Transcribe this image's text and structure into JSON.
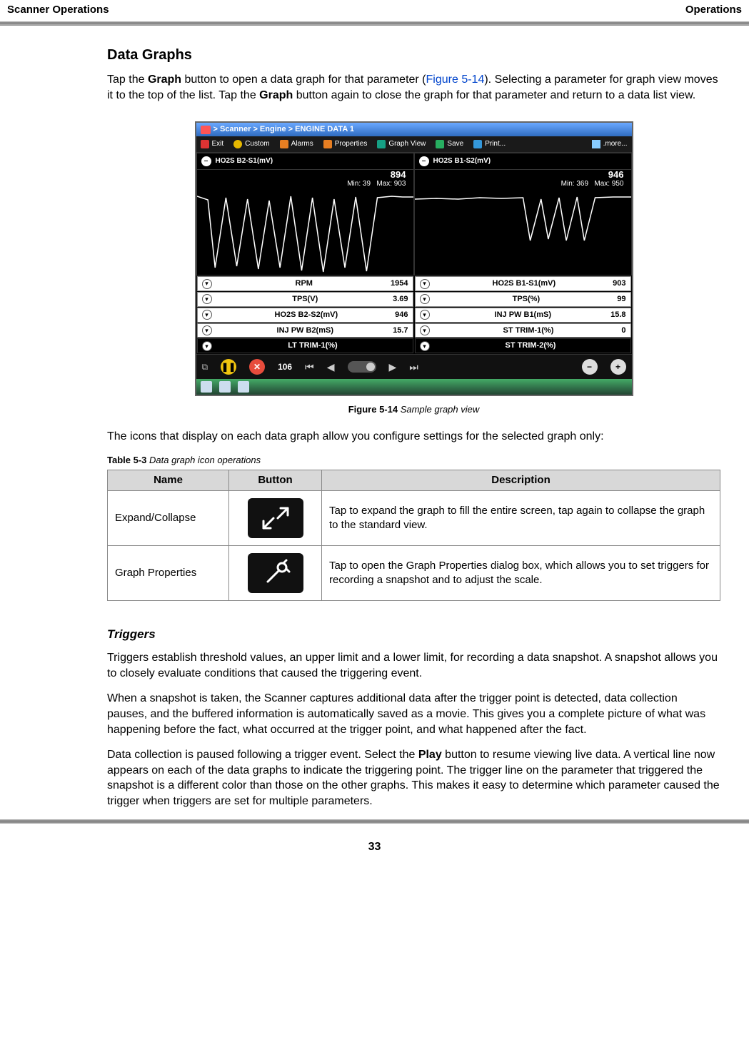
{
  "header": {
    "left": "Scanner Operations",
    "right": "Operations"
  },
  "section": {
    "heading": "Data Graphs",
    "para1_a": "Tap the ",
    "para1_b_bold": "Graph",
    "para1_c": " button to open a data graph for that parameter (",
    "para1_figref": "Figure 5-14",
    "para1_d": "). Selecting a parameter for graph view moves it to the top of the list. Tap the ",
    "para1_e_bold": "Graph",
    "para1_f": " button again to close the graph for that parameter and return to a data list view."
  },
  "screenshot": {
    "breadcrumb": "> Scanner  > Engine  > ENGINE DATA 1",
    "toolbar": {
      "exit": "Exit",
      "custom": "Custom",
      "alarms": "Alarms",
      "properties": "Properties",
      "graphview": "Graph View",
      "save": "Save",
      "print": "Print...",
      "more": ".more..."
    },
    "graphs": [
      {
        "title": "HO2S B2-S1(mV)",
        "value": "894",
        "min": "Min: 39",
        "max": "Max: 903"
      },
      {
        "title": "HO2S B1-S2(mV)",
        "value": "946",
        "min": "Min: 369",
        "max": "Max: 950"
      }
    ],
    "rows_left": [
      {
        "label": "RPM",
        "value": "1954"
      },
      {
        "label": "TPS(V)",
        "value": "3.69"
      },
      {
        "label": "HO2S B2-S2(mV)",
        "value": "946"
      },
      {
        "label": "INJ PW B2(mS)",
        "value": "15.7"
      },
      {
        "label": "LT TRIM-1(%)",
        "value": ""
      }
    ],
    "rows_right": [
      {
        "label": "HO2S B1-S1(mV)",
        "value": "903"
      },
      {
        "label": "TPS(%)",
        "value": "99"
      },
      {
        "label": "INJ PW B1(mS)",
        "value": "15.8"
      },
      {
        "label": "ST TRIM-1(%)",
        "value": "0"
      },
      {
        "label": "ST TRIM-2(%)",
        "value": ""
      }
    ],
    "frame_counter": "106"
  },
  "figure_caption": {
    "label": "Figure 5-14",
    "text": " Sample graph view"
  },
  "para2": "The icons that display on each data graph allow you configure settings for the selected graph only:",
  "table_caption": {
    "label": "Table 5-3",
    "text": " Data graph icon operations"
  },
  "table": {
    "headers": {
      "name": "Name",
      "button": "Button",
      "description": "Description"
    },
    "rows": [
      {
        "name": "Expand/Collapse",
        "description": "Tap to expand the graph to fill the entire screen, tap again to collapse the graph to the standard view."
      },
      {
        "name": "Graph Properties",
        "description": "Tap to open the Graph Properties dialog box, which allows you to set triggers for recording a snapshot and to adjust the scale."
      }
    ]
  },
  "triggers": {
    "heading": "Triggers",
    "p1": "Triggers establish threshold values, an upper limit and a lower limit, for recording a data snapshot. A snapshot allows you to closely evaluate conditions that caused the triggering event.",
    "p2": "When a snapshot is taken, the Scanner captures additional data after the trigger point is detected, data collection pauses, and the buffered information is automatically saved as a movie. This gives you a complete picture of what was happening before the fact, what occurred at the trigger point, and what happened after the fact.",
    "p3_a": "Data collection is paused following a trigger event. Select the ",
    "p3_b_bold": "Play",
    "p3_c": " button to resume viewing live data. A vertical line now appears on each of the data graphs to indicate the triggering point. The trigger line on the parameter that triggered the snapshot is a different color than those on the other graphs. This makes it easy to determine which parameter caused the trigger when triggers are set for multiple parameters."
  },
  "chart_data": [
    {
      "type": "line",
      "title": "HO2S B2-S1(mV)",
      "xlabel": "",
      "ylabel": "mV",
      "ylim": [
        0,
        950
      ],
      "annotation": {
        "current": 894,
        "min": 39,
        "max": 903
      },
      "x": [
        0,
        5,
        10,
        15,
        20,
        25,
        30,
        35,
        40,
        45,
        50,
        55,
        60,
        65,
        70,
        75,
        80,
        85,
        90,
        95,
        100
      ],
      "values": [
        900,
        850,
        100,
        880,
        120,
        870,
        90,
        860,
        110,
        900,
        80,
        880,
        60,
        870,
        100,
        890,
        70,
        880,
        900,
        895,
        894
      ]
    },
    {
      "type": "line",
      "title": "HO2S B1-S2(mV)",
      "xlabel": "",
      "ylabel": "mV",
      "ylim": [
        0,
        1000
      ],
      "annotation": {
        "current": 946,
        "min": 369,
        "max": 950
      },
      "x": [
        0,
        10,
        20,
        30,
        40,
        50,
        55,
        60,
        65,
        70,
        75,
        80,
        85,
        90,
        95,
        100
      ],
      "values": [
        930,
        935,
        930,
        940,
        935,
        940,
        400,
        930,
        420,
        940,
        410,
        945,
        400,
        940,
        945,
        946
      ]
    }
  ],
  "page_number": "33"
}
